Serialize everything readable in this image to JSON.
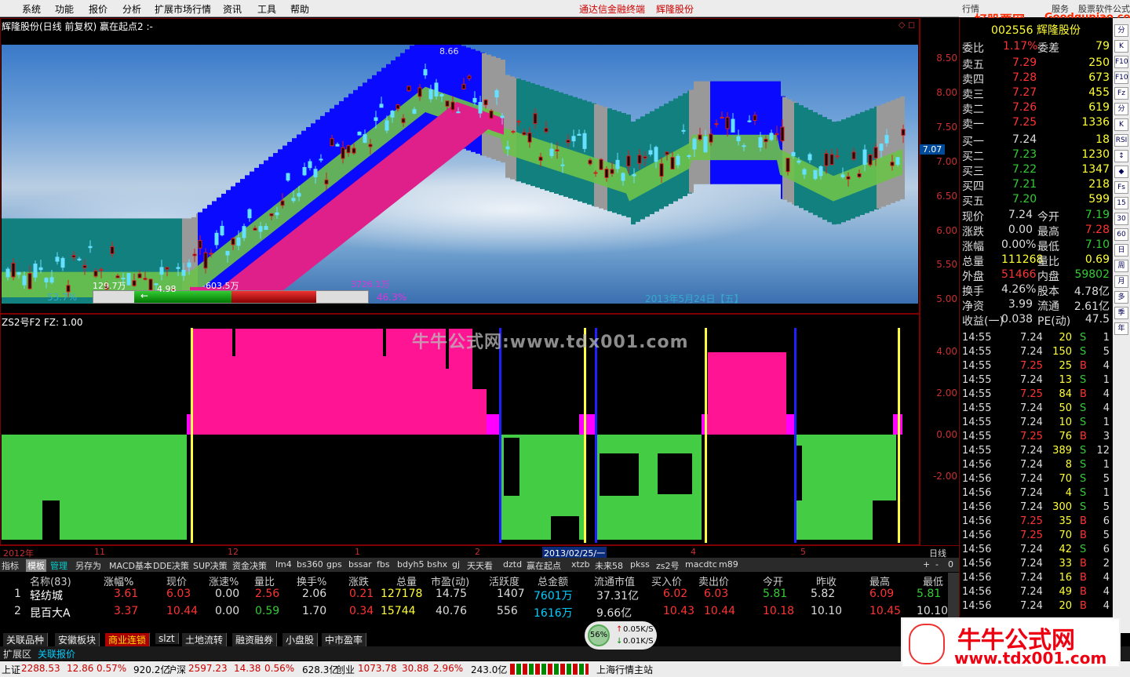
{
  "menu": {
    "items": [
      "系统",
      "功能",
      "报价",
      "分析",
      "扩展市场行情",
      "资讯",
      "工具",
      "帮助"
    ],
    "center1": "通达信金融终端",
    "center2": "辉隆股份",
    "right_tab": "行情",
    "right_extra": "服务",
    "right_formula": "股票软件公式"
  },
  "site_logo": {
    "name": "好股票网",
    "url": "Goodgupiao.com"
  },
  "kchart": {
    "title": "辉隆股份(日线 前复权) 赢在起点2 :-",
    "price_labels": [
      "8.50",
      "8.00",
      "7.50",
      "7.00",
      "6.50",
      "6.00",
      "5.50",
      "5.00"
    ],
    "current_price": "7.07",
    "high_label": "8.66",
    "low_label": "4.98",
    "vol1": "129.7万",
    "vol2": "-603.5万",
    "vol3": "3726.1万",
    "pct_left": "53.7%",
    "pct_right": "46.3%",
    "date_label": "2013年5月24日【五】"
  },
  "indicator": {
    "title": "ZS2号F2 FZ: 1.00",
    "labels": [
      "4.00",
      "2.00",
      "0.00",
      "-2.00"
    ],
    "watermark": "牛牛公式网:www.tdx001.com"
  },
  "date_axis": {
    "labels": [
      "2012年",
      "11",
      "12",
      "1",
      "2",
      "2013/02/25/一",
      "4",
      "5"
    ],
    "period": "日线"
  },
  "tabs1": [
    "指标",
    "模板",
    "管理",
    "另存为",
    "MACD基本",
    "DDE决策",
    "SUP决策",
    "资金决策",
    "lm4",
    "bs360",
    "gps",
    "bssar",
    "fbs",
    "bdyh5",
    "bshx",
    "gj",
    "天天看",
    "dztd",
    "赢在起点",
    "xtzb",
    "未来58",
    "pkss",
    "zs2号",
    "macdtc",
    "m89"
  ],
  "quote_headers": [
    "名称(83)",
    "涨幅%",
    "现价",
    "涨速%",
    "量比",
    "换手%",
    "涨跌",
    "总量",
    "市盈(动)",
    "活跃度",
    "总金额",
    "流通市值",
    "买入价",
    "卖出价",
    "今开",
    "昨收",
    "最高",
    "最低"
  ],
  "quote_rows": [
    {
      "idx": "1",
      "name": "轻纺城",
      "chg": "3.61",
      "price": "6.03",
      "speed": "0.00",
      "vr": "2.56",
      "turn": "2.06",
      "diff": "0.21",
      "vol": "127178",
      "pe": "14.75",
      "act": "1407",
      "amt": "7601万",
      "mcap": "37.31亿",
      "bid": "6.02",
      "ask": "6.03",
      "open": "5.81",
      "prev": "5.82",
      "high": "6.09",
      "low": "5.81"
    },
    {
      "idx": "2",
      "name": "昆百大A",
      "chg": "3.37",
      "price": "10.44",
      "speed": "0.00",
      "vr": "0.59",
      "turn": "1.70",
      "diff": "0.34",
      "vol": "15744",
      "pe": "40.76",
      "act": "556",
      "amt": "1616万",
      "mcap": "9.66亿",
      "bid": "10.43",
      "ask": "10.44",
      "open": "10.18",
      "prev": "10.10",
      "high": "10.45",
      "low": "10.10"
    }
  ],
  "bottom_tabs": [
    "关联品种",
    "安徽板块",
    "商业连锁",
    "slzt",
    "土地流转",
    "融资融券",
    "小盘股",
    "中市盈率"
  ],
  "tabs2": [
    "扩展区",
    "关联报价"
  ],
  "status": {
    "sh_label": "上证",
    "sh": "2288.53",
    "sh_chg": "12.86",
    "sh_pct": "0.57%",
    "sh_amt": "920.2亿",
    "hs_label": "沪深",
    "hs": "2597.23",
    "hs_chg": "14.38",
    "hs_pct": "0.56%",
    "hs_amt": "628.3亿",
    "cy_label": "创业",
    "cy": "1073.78",
    "cy_chg": "30.88",
    "cy_pct": "2.96%",
    "cy_amt": "243.0亿",
    "server": "上海行情主站"
  },
  "net": {
    "pct": "56%",
    "up": "0.05K/S",
    "down": "0.01K/S"
  },
  "right": {
    "code_name": "002556 辉隆股份",
    "wb": {
      "l": "委比",
      "v": "1.17%",
      "l2": "委差",
      "v2": "79"
    },
    "asks": [
      [
        "卖五",
        "7.29",
        "250"
      ],
      [
        "卖四",
        "7.28",
        "673"
      ],
      [
        "卖三",
        "7.27",
        "455"
      ],
      [
        "卖二",
        "7.26",
        "619"
      ],
      [
        "卖一",
        "7.25",
        "1336"
      ]
    ],
    "bids": [
      [
        "买一",
        "7.24",
        "18"
      ],
      [
        "买二",
        "7.23",
        "1230"
      ],
      [
        "买三",
        "7.22",
        "1347"
      ],
      [
        "买四",
        "7.21",
        "218"
      ],
      [
        "买五",
        "7.20",
        "599"
      ]
    ],
    "stats": [
      [
        "现价",
        "7.24",
        "今开",
        "7.19"
      ],
      [
        "涨跌",
        "0.00",
        "最高",
        "7.28"
      ],
      [
        "涨幅",
        "0.00%",
        "最低",
        "7.10"
      ],
      [
        "总量",
        "111268",
        "量比",
        "0.69"
      ],
      [
        "外盘",
        "51466",
        "内盘",
        "59802"
      ],
      [
        "换手",
        "4.26%",
        "股本",
        "4.78亿"
      ],
      [
        "净资",
        "3.99",
        "流通",
        "2.61亿"
      ],
      [
        "收益(一)",
        "0.038",
        "PE(动)",
        "47.5"
      ]
    ],
    "ticks": [
      [
        "14:55",
        "7.24",
        "20",
        "S",
        "1"
      ],
      [
        "14:55",
        "7.24",
        "150",
        "S",
        "5"
      ],
      [
        "14:55",
        "7.25",
        "25",
        "B",
        "4"
      ],
      [
        "14:55",
        "7.24",
        "13",
        "S",
        "1"
      ],
      [
        "14:55",
        "7.25",
        "84",
        "B",
        "4"
      ],
      [
        "14:55",
        "7.24",
        "50",
        "S",
        "4"
      ],
      [
        "14:55",
        "7.24",
        "10",
        "S",
        "1"
      ],
      [
        "14:55",
        "7.25",
        "76",
        "B",
        "3"
      ],
      [
        "14:55",
        "7.24",
        "389",
        "S",
        "12"
      ],
      [
        "14:56",
        "7.24",
        "8",
        "S",
        "1"
      ],
      [
        "14:56",
        "7.24",
        "70",
        "S",
        "5"
      ],
      [
        "14:56",
        "7.24",
        "4",
        "S",
        "1"
      ],
      [
        "14:56",
        "7.24",
        "300",
        "S",
        "5"
      ],
      [
        "14:56",
        "7.25",
        "35",
        "B",
        "6"
      ],
      [
        "14:56",
        "7.25",
        "70",
        "B",
        "5"
      ],
      [
        "14:56",
        "7.24",
        "42",
        "S",
        "6"
      ],
      [
        "14:56",
        "7.24",
        "33",
        "B",
        "2"
      ],
      [
        "14:56",
        "7.24",
        "16",
        "B",
        "4"
      ],
      [
        "14:56",
        "7.24",
        "49",
        "B",
        "4"
      ],
      [
        "14:56",
        "7.24",
        "20",
        "B",
        "4"
      ]
    ]
  },
  "side_icons": [
    "分",
    "K",
    "F10",
    "F10",
    "Fz",
    "分",
    "K",
    "RSI",
    "↕",
    "◆",
    "Fs",
    "15",
    "30",
    "60",
    "日",
    "周",
    "月",
    "多",
    "季",
    "年"
  ],
  "logo2": {
    "name": "牛牛公式网",
    "url": "www.tdx001.com"
  }
}
